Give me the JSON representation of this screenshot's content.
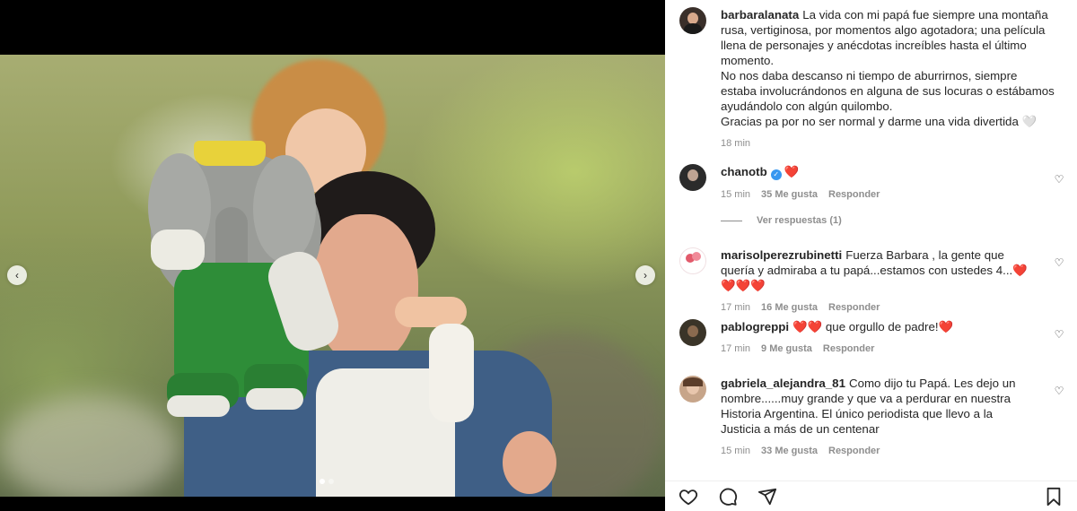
{
  "media": {
    "photo_description_icon": "post-photo",
    "prev_label": "‹",
    "next_label": "›",
    "dots_count": 2,
    "active_dot": 0
  },
  "caption": {
    "username": "barbaralanata",
    "lines": [
      "La vida con mi papá fue siempre una montaña rusa, vertiginosa, por momentos algo agotadora; una película llena de personajes y anécdotas increíbles hasta el último momento.",
      "No nos daba descanso ni tiempo de aburrirnos, siempre estaba involucrándonos en alguna de sus locuras o estábamos ayudándolo con algún quilombo.",
      "Gracias pa por no ser normal y darme una vida divertida 🤍"
    ],
    "time": "18 min"
  },
  "comments": [
    {
      "username": "chanotb",
      "verified": true,
      "text": "❤️",
      "time": "15 min",
      "likes": "35 Me gusta",
      "reply": "Responder",
      "avatar_color": "#2b2b2b"
    },
    {
      "username": "marisolperezrubinetti",
      "verified": false,
      "text": "Fuerza Barbara , la gente que quería y admiraba a tu papá...estamos con ustedes 4...❤️❤️❤️❤️",
      "time": "17 min",
      "likes": "16 Me gusta",
      "reply": "Responder",
      "avatar_color": "#f2c9cf"
    },
    {
      "username": "pablogreppi",
      "verified": false,
      "text": "❤️❤️ que orgullo de padre!❤️",
      "time": "17 min",
      "likes": "9 Me gusta",
      "reply": "Responder",
      "avatar_color": "#3a3428"
    },
    {
      "username": "gabriela_alejandra_81",
      "verified": false,
      "text": "Como dijo tu Papá. Les dejo un nombre......muy grande y que va a perdurar en nuestra Historia Argentina. El único periodista que llevo a la Justicia a más de un centenar",
      "time": "15 min",
      "likes": "33 Me gusta",
      "reply": "Responder",
      "avatar_color": "#c7a58a"
    }
  ],
  "view_replies": "Ver respuestas (1)",
  "actions": {
    "like_icon": "heart-outline-icon",
    "comment_icon": "comment-icon",
    "share_icon": "send-icon",
    "save_icon": "bookmark-icon"
  },
  "colors": {
    "verified": "#3897f0",
    "text": "#262626",
    "secondary": "#8e8e8e"
  }
}
